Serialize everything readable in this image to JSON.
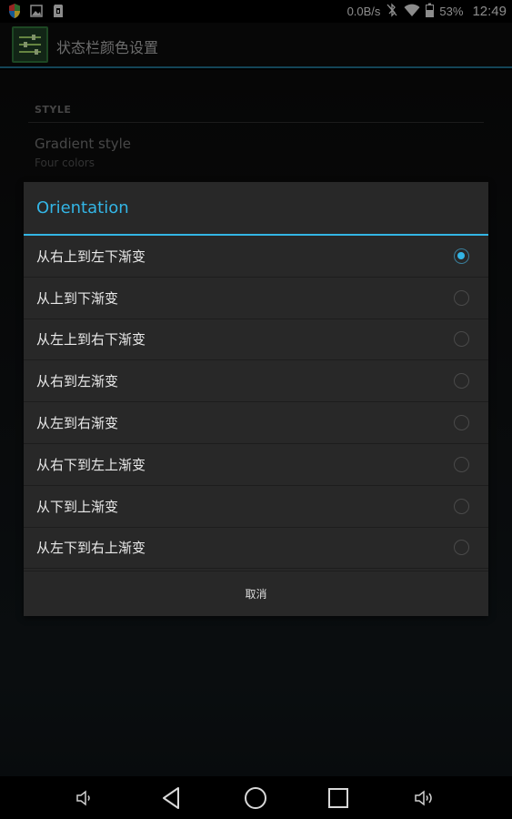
{
  "status_bar": {
    "network_speed": "0.0B/s",
    "battery": "53%",
    "time": "12:49",
    "icons": [
      "shield-icon",
      "image-icon",
      "sd-card-icon",
      "bluetooth-off-icon",
      "wifi-icon",
      "battery-icon"
    ]
  },
  "action_bar": {
    "title": "状态栏颜色设置",
    "icon": "equalizer-sliders-icon"
  },
  "settings": {
    "section_header": "STYLE",
    "pref_title": "Gradient style",
    "pref_summary": "Four colors"
  },
  "dialog": {
    "title": "Orientation",
    "options": [
      {
        "label": "从右上到左下渐变",
        "checked": true
      },
      {
        "label": "从上到下渐变",
        "checked": false
      },
      {
        "label": "从左上到右下渐变",
        "checked": false
      },
      {
        "label": "从右到左渐变",
        "checked": false
      },
      {
        "label": "从左到右渐变",
        "checked": false
      },
      {
        "label": "从右下到左上渐变",
        "checked": false
      },
      {
        "label": "从下到上渐变",
        "checked": false
      },
      {
        "label": "从左下到右上渐变",
        "checked": false
      }
    ],
    "cancel_label": "取消"
  },
  "nav_bar": {
    "buttons": [
      "volume-down-icon",
      "back-icon",
      "home-icon",
      "recents-icon",
      "volume-up-icon"
    ]
  },
  "colors": {
    "accent": "#33b5e5",
    "dialog_bg": "#282828"
  }
}
